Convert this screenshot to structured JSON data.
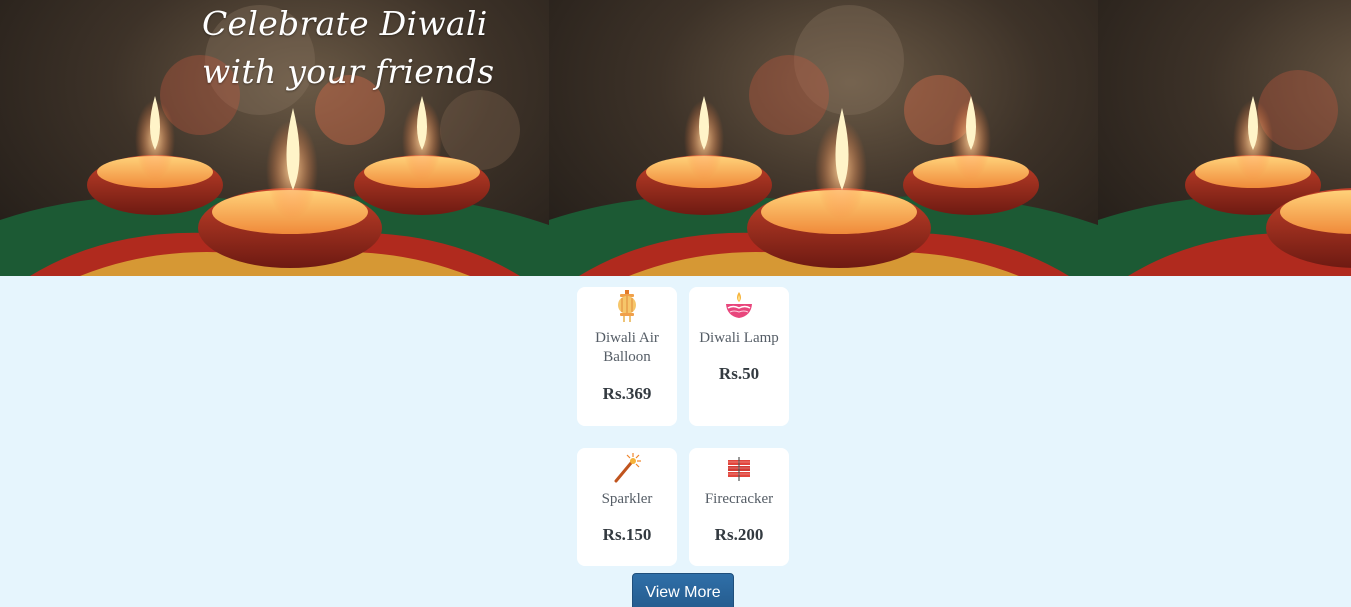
{
  "hero": {
    "title": "Celebrate Diwali with your friends"
  },
  "products": [
    {
      "name": "Diwali Air Balloon",
      "price": "Rs.369",
      "icon": "lantern-icon"
    },
    {
      "name": "Diwali Lamp",
      "price": "Rs.50",
      "icon": "diya-icon"
    },
    {
      "name": "Sparkler",
      "price": "Rs.150",
      "icon": "sparkler-icon"
    },
    {
      "name": "Firecracker",
      "price": "Rs.200",
      "icon": "firecracker-icon"
    }
  ],
  "actions": {
    "view_more": "View More"
  }
}
